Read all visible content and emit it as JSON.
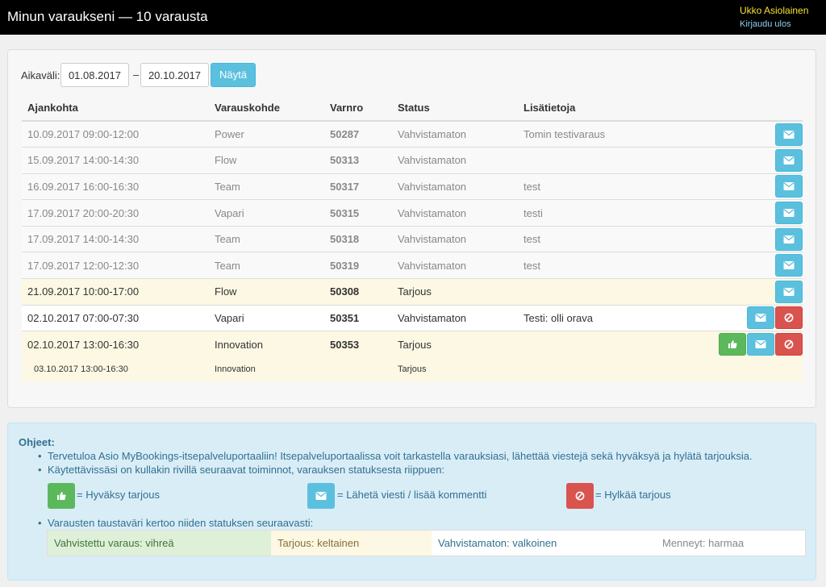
{
  "header": {
    "title": "Minun varaukseni — 10 varausta",
    "user": "Ukko Asiolainen",
    "logout": "Kirjaudu ulos"
  },
  "filter": {
    "label": "Aikaväli:",
    "from": "01.08.2017",
    "sep": "–",
    "to": "20.10.2017",
    "button": "Näytä"
  },
  "table": {
    "headers": [
      "Ajankohta",
      "Varauskohde",
      "Varnro",
      "Status",
      "Lisätietoja"
    ],
    "rows": [
      {
        "time": "10.09.2017 09:00-12:00",
        "target": "Power",
        "nro": "50287",
        "status": "Vahvistamaton",
        "info": "Tomin testivaraus"
      },
      {
        "time": "15.09.2017 14:00-14:30",
        "target": "Flow",
        "nro": "50313",
        "status": "Vahvistamaton",
        "info": ""
      },
      {
        "time": "16.09.2017 16:00-16:30",
        "target": "Team",
        "nro": "50317",
        "status": "Vahvistamaton",
        "info": "test"
      },
      {
        "time": "17.09.2017 20:00-20:30",
        "target": "Vapari",
        "nro": "50315",
        "status": "Vahvistamaton",
        "info": "testi"
      },
      {
        "time": "17.09.2017 14:00-14:30",
        "target": "Team",
        "nro": "50318",
        "status": "Vahvistamaton",
        "info": "test"
      },
      {
        "time": "17.09.2017 12:00-12:30",
        "target": "Team",
        "nro": "50319",
        "status": "Vahvistamaton",
        "info": "test"
      },
      {
        "time": "21.09.2017 10:00-17:00",
        "target": "Flow",
        "nro": "50308",
        "status": "Tarjous",
        "info": ""
      },
      {
        "time": "02.10.2017 07:00-07:30",
        "target": "Vapari",
        "nro": "50351",
        "status": "Vahvistamaton",
        "info": "Testi: olli orava"
      },
      {
        "time": "02.10.2017 13:00-16:30",
        "target": "Innovation",
        "nro": "50353",
        "status": "Tarjous",
        "info": ""
      }
    ],
    "sub_row": {
      "time": "03.10.2017 13:00-16:30",
      "target": "Innovation",
      "status": "Tarjous"
    }
  },
  "help": {
    "heading": "Ohjeet:",
    "line1": "Tervetuloa Asio MyBookings-itsepalveluportaaliin! Itsepalveluportaalissa voit tarkastella varauksiasi, lähettää viestejä sekä hyväksyä ja hylätä tarjouksia.",
    "line2": "Käytettävissäsi on kullakin rivillä seuraavat toiminnot, varauksen statuksesta riippuen:",
    "accept": "= Hyväksy tarjous",
    "message": "= Lähetä viesti / lisää kommentti",
    "reject": "= Hylkää tarjous",
    "line3": "Varausten taustaväri kertoo niiden statuksen seuraavasti:",
    "colors": {
      "confirmed": "Vahvistettu varaus: vihreä",
      "offer": "Tarjous: keltainen",
      "unconfirmed": "Vahvistamaton: valkoinen",
      "past": "Menneyt: harmaa"
    }
  },
  "icons": {
    "message": "envelope-icon",
    "reject": "ban-icon",
    "accept": "thumbs-up-icon"
  },
  "colors": {
    "info": "#5bc0de",
    "danger": "#d9534f",
    "success": "#5cb85c",
    "offer_bg": "#fcf8e3",
    "past_bg": "#f9f9f9"
  }
}
